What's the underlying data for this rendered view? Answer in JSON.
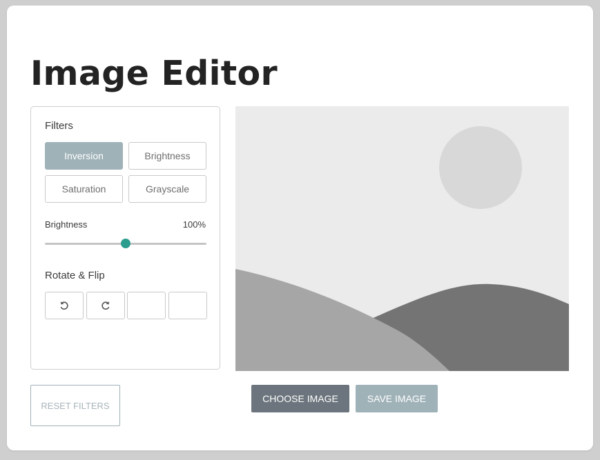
{
  "header": {
    "title": "Image Editor"
  },
  "filters": {
    "title": "Filters",
    "options": [
      "Inversion",
      "Brightness",
      "Saturation",
      "Grayscale"
    ],
    "active": "Inversion"
  },
  "slider": {
    "label": "Brightness",
    "value_text": "100%",
    "fraction": 0.5
  },
  "rotate_flip": {
    "title": "Rotate & Flip",
    "buttons": [
      {
        "icon": "rotate-left-icon"
      },
      {
        "icon": "rotate-right-icon"
      },
      {
        "icon": ""
      },
      {
        "icon": ""
      }
    ]
  },
  "actions": {
    "reset_label": "RESET FILTERS",
    "choose_label": "CHOOSE IMAGE",
    "save_label": "SAVE IMAGE"
  },
  "preview": {
    "icon": "image-placeholder-icon"
  },
  "colors": {
    "accent": "#2a9d8f",
    "active_button": "#9fb2b8",
    "choose_button": "#6c757d"
  }
}
